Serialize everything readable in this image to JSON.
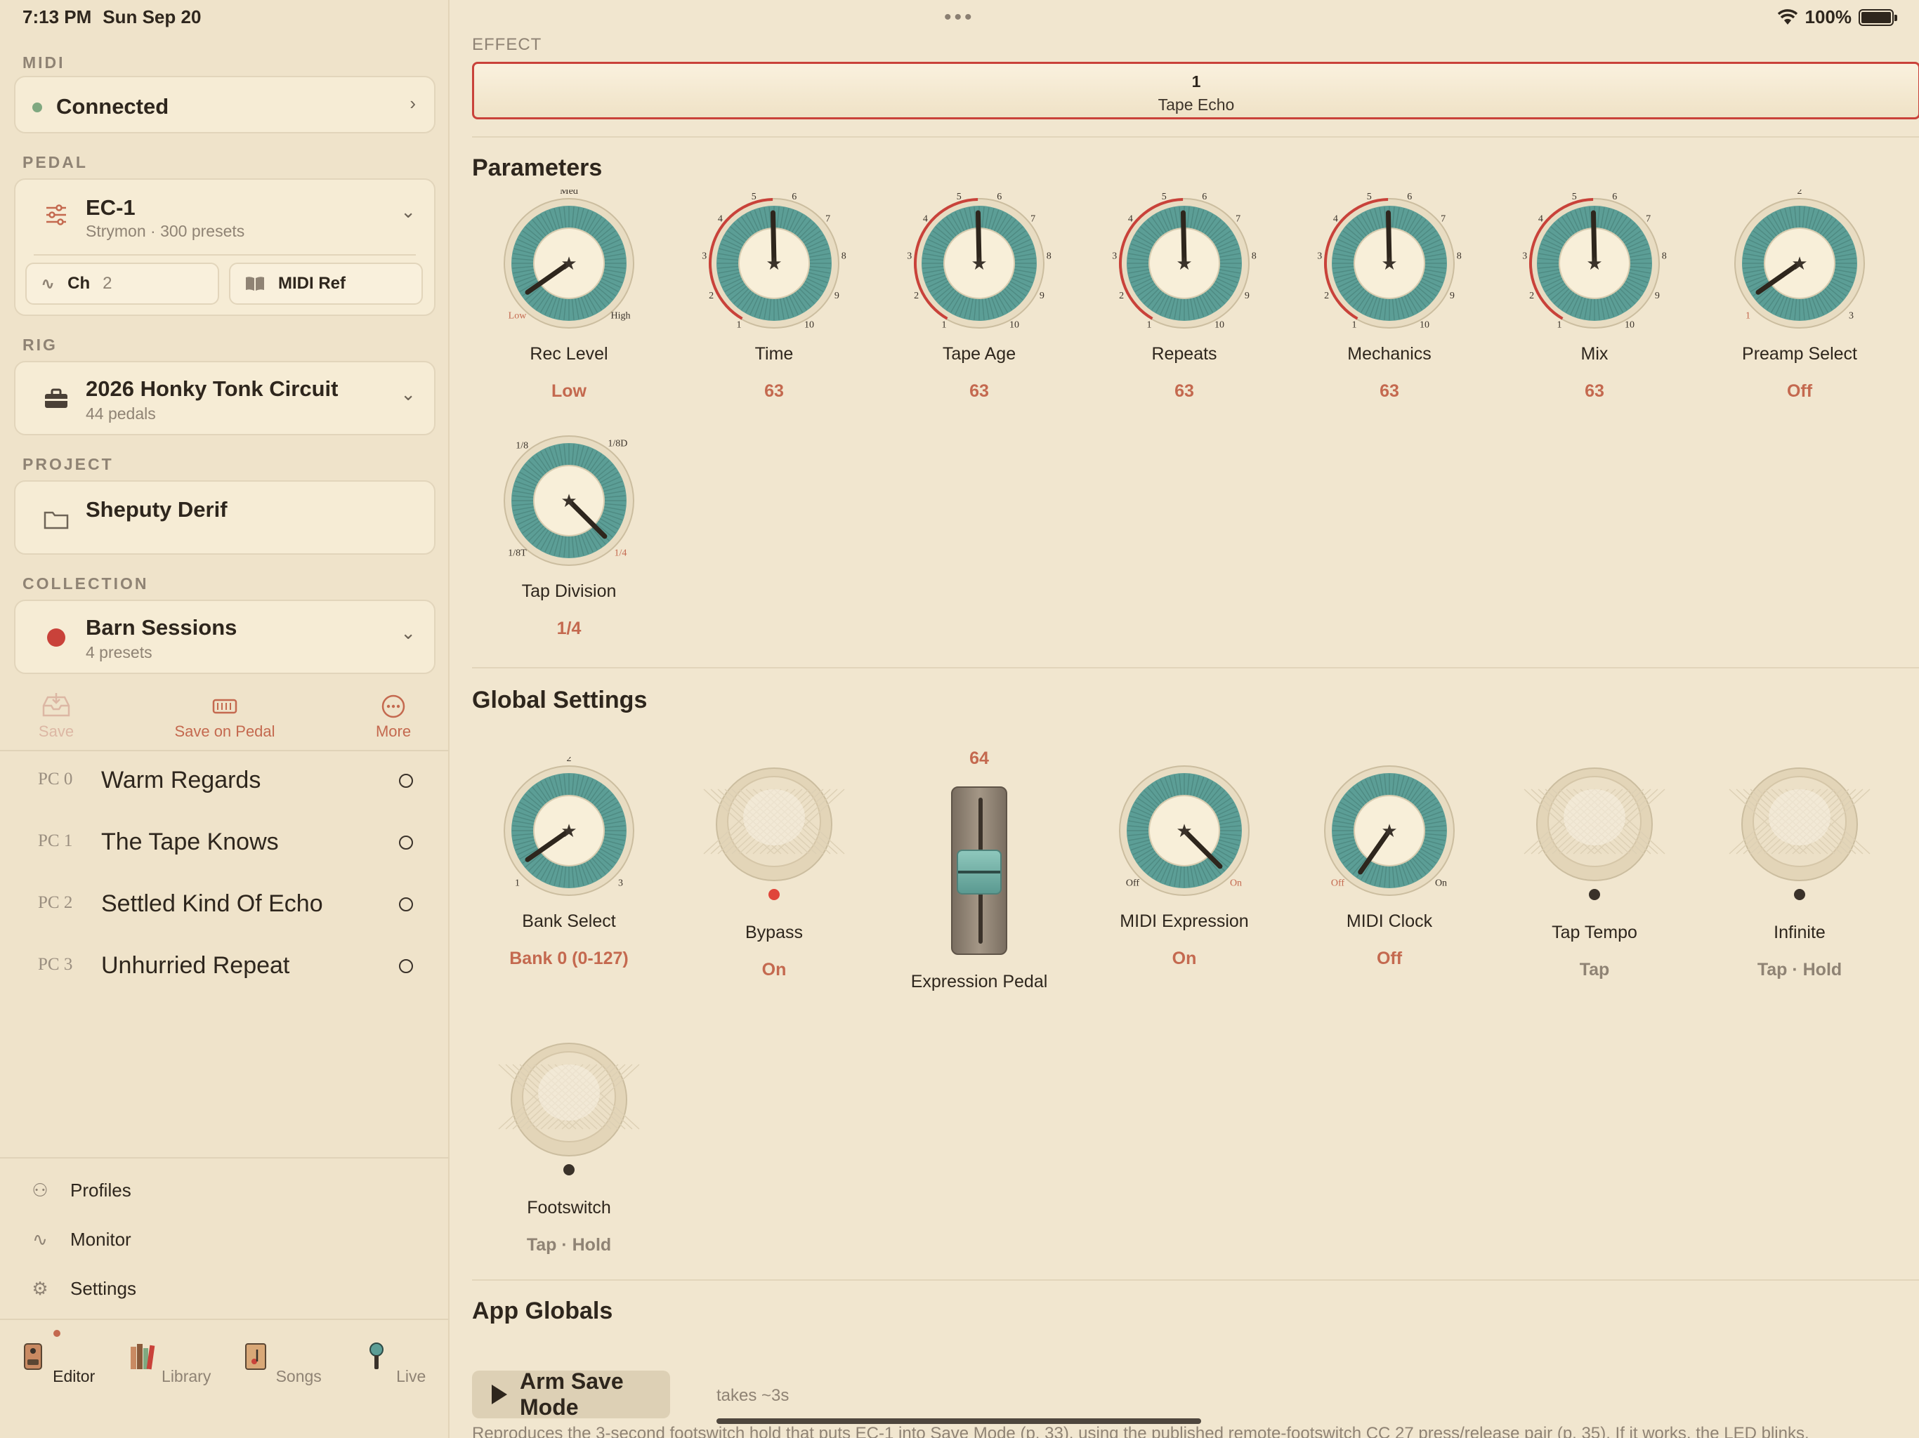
{
  "status_bar": {
    "time": "7:13 PM",
    "date": "Sun Sep 20",
    "battery": "100%",
    "more": "•••"
  },
  "sidebar": {
    "midi": {
      "label": "MIDI",
      "status": "Connected",
      "status_color": "#7fa880"
    },
    "pedal": {
      "label": "PEDAL",
      "name": "EC-1",
      "subtitle": "Strymon · 300 presets",
      "channel_label": "Ch",
      "channel_value": "2",
      "midi_ref_label": "MIDI Ref"
    },
    "rig": {
      "label": "RIG",
      "name": "2026 Honky Tonk Circuit",
      "subtitle": "44 pedals"
    },
    "project": {
      "label": "PROJECT",
      "name": "Sheputy Derif"
    },
    "collection": {
      "label": "COLLECTION",
      "name": "Barn Sessions",
      "subtitle": "4 presets",
      "color": "#c9423a"
    },
    "actions": [
      {
        "label": "Save",
        "icon": "inbox-icon"
      },
      {
        "label": "Save on Pedal",
        "icon": "chip-icon"
      },
      {
        "label": "More",
        "icon": "ellipsis-circle-icon"
      }
    ],
    "presets": [
      {
        "pc": "PC 0",
        "name": "Warm Regards"
      },
      {
        "pc": "PC 1",
        "name": "The Tape Knows"
      },
      {
        "pc": "PC 2",
        "name": "Settled Kind Of Echo"
      },
      {
        "pc": "PC 3",
        "name": "Unhurried Repeat"
      }
    ],
    "nav": [
      {
        "label": "Profiles",
        "icon": "profiles-icon"
      },
      {
        "label": "Monitor",
        "icon": "waveform-icon"
      },
      {
        "label": "Settings",
        "icon": "gear-icon"
      }
    ],
    "tabs": [
      {
        "label": "Editor",
        "icon": "editor-icon",
        "active": true
      },
      {
        "label": "Library",
        "icon": "library-icon",
        "active": false
      },
      {
        "label": "Songs",
        "icon": "songs-icon",
        "active": false
      },
      {
        "label": "Live",
        "icon": "microphone-icon",
        "active": false
      }
    ]
  },
  "main": {
    "effect": {
      "label": "EFFECT",
      "number": "1",
      "name": "Tape Echo"
    },
    "parameters": {
      "title": "Parameters",
      "knobs": [
        {
          "label": "Rec Level",
          "value": "Low",
          "type": "stepped",
          "labels": [
            "Low",
            "Med",
            "High"
          ],
          "position": 0
        },
        {
          "label": "Time",
          "value": "63",
          "type": "numbered",
          "level": 0.496
        },
        {
          "label": "Tape Age",
          "value": "63",
          "type": "numbered",
          "level": 0.496
        },
        {
          "label": "Repeats",
          "value": "63",
          "type": "numbered",
          "level": 0.496
        },
        {
          "label": "Mechanics",
          "value": "63",
          "type": "numbered",
          "level": 0.496
        },
        {
          "label": "Mix",
          "value": "63",
          "type": "numbered",
          "level": 0.496
        },
        {
          "label": "Preamp Select",
          "value": "Off",
          "type": "stepped",
          "labels": [
            "1",
            "2",
            "3"
          ],
          "position": 0
        },
        {
          "label": "Tap Division",
          "value": "1/4",
          "type": "stepped4",
          "labels": [
            "1/8T",
            "1/8",
            "1/8D",
            "1/4"
          ],
          "position": 3
        }
      ],
      "dial_numbers": [
        "1",
        "2",
        "3",
        "4",
        "5",
        "6",
        "7",
        "8",
        "9",
        "10"
      ]
    },
    "global_settings": {
      "title": "Global Settings",
      "bank_select": {
        "label": "Bank Select",
        "value": "Bank 0 (0-127)",
        "labels": [
          "1",
          "2",
          "3"
        ],
        "position": 0
      },
      "bypass": {
        "label": "Bypass",
        "value": "On",
        "led": "#e0453a"
      },
      "expression_pedal": {
        "label": "Expression Pedal",
        "value": "64",
        "level": 0.5
      },
      "midi_expression": {
        "label": "MIDI Expression",
        "value": "On",
        "labels": [
          "Off",
          "On"
        ],
        "position": 1
      },
      "midi_clock": {
        "label": "MIDI Clock",
        "value": "Off",
        "labels": [
          "Off",
          "On"
        ],
        "position": 0
      },
      "tap_tempo": {
        "label": "Tap Tempo",
        "value": "Tap",
        "led": "#3a322a"
      },
      "infinite": {
        "label": "Infinite",
        "value": "Tap · Hold",
        "led": "#3a322a"
      },
      "footswitch": {
        "label": "Footswitch",
        "value": "Tap · Hold",
        "led": "#3a322a"
      }
    },
    "app_globals": {
      "title": "App Globals",
      "arm_button": "Arm Save Mode",
      "takes": "takes ~3s",
      "description": "Reproduces the 3-second footswitch hold that puts EC-1 into Save Mode (p. 33), using the published remote-footswitch CC 27 press/release pair (p. 35). If it works, the LED blinks."
    },
    "colors": {
      "accent": "#c4694f",
      "teal": "#5c9e96",
      "red": "#c9423a"
    }
  }
}
